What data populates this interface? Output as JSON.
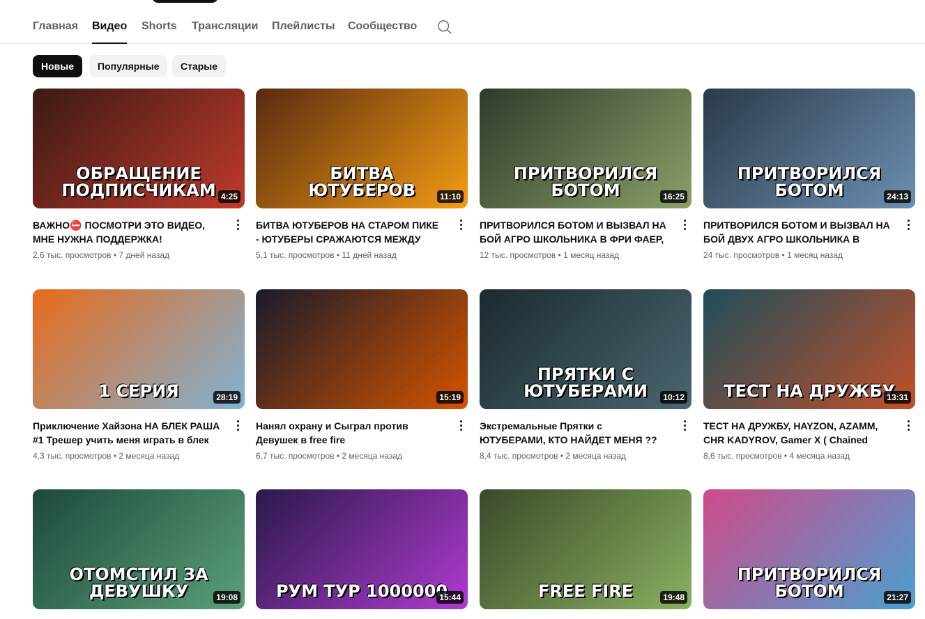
{
  "tabs": [
    "Главная",
    "Видео",
    "Shorts",
    "Трансляции",
    "Плейлисты",
    "Сообщество"
  ],
  "active_tab": 1,
  "chips": [
    "Новые",
    "Популярные",
    "Старые"
  ],
  "videos": [
    {
      "title": "ВАЖНО⛔ ПОСМОТРИ ЭТО ВИДЕО, МНЕ НУЖНА ПОДДЕРЖКА!",
      "views": "2,6 тыс. просмотров",
      "age": "7 дней назад",
      "duration": "4:25",
      "thumb_text": "ОБРАЩЕНИЕ ПОДПИСЧИКАМ",
      "colors": [
        "#3a1a14",
        "#c0392b"
      ]
    },
    {
      "title": "БИТВА ЮТУБЕРОВ НА СТАРОМ ПИКЕ - ЮТУБЕРЫ СРАЖАЮТСЯ МЕЖДУ СОБОЙ",
      "views": "5,1 тыс. просмотров",
      "age": "11 дней назад",
      "duration": "11:10",
      "thumb_text": "БИТВА ЮТУБЕРОВ",
      "colors": [
        "#5a2a10",
        "#f39c12"
      ]
    },
    {
      "title": "ПРИТВОРИЛСЯ БОТОМ И ВЫЗВАЛ НА БОЙ АГРО ШКОЛЬНИКА В ФРИ ФАЕР, Я...",
      "views": "12 тыс. просмотров",
      "age": "1 месяц назад",
      "duration": "16:25",
      "thumb_text": "ПРИТВОРИЛСЯ БОТОМ",
      "colors": [
        "#2f3b2a",
        "#8aa06a"
      ]
    },
    {
      "title": "ПРИТВОРИЛСЯ БОТОМ И ВЫЗВАЛ НА БОЙ ДВУХ АГРО ШКОЛЬНИКА В ФРИ...",
      "views": "24 тыс. просмотров",
      "age": "1 месяц назад",
      "duration": "24:13",
      "thumb_text": "ПРИТВОРИЛСЯ БОТОМ",
      "colors": [
        "#2a3a4a",
        "#6d8fb0"
      ]
    },
    {
      "title": "Приключение Хайзона НА БЛЕК РАША #1 Трешер учить меня играть в блек Раша",
      "views": "4,3 тыс. просмотров",
      "age": "2 месяца назад",
      "duration": "28:19",
      "thumb_text": "1 СЕРИЯ",
      "colors": [
        "#e86a1a",
        "#7fb3d5"
      ]
    },
    {
      "title": "Нанял охрану и Сыграл против Девушек в free fire",
      "views": "6,7 тыс. просмотров",
      "age": "2 месяца назад",
      "duration": "15:19",
      "thumb_text": "",
      "colors": [
        "#1a1a2a",
        "#d35400"
      ]
    },
    {
      "title": "Экстремальные Прятки с ЮТУБЕРАМИ, КТО НАЙДЕТ МЕНЯ ?? ФРИ ФАЕР",
      "views": "8,4 тыс. просмотров",
      "age": "2 месяца назад",
      "duration": "10:12",
      "thumb_text": "ПРЯТКИ С ЮТУБЕРАМИ",
      "colors": [
        "#1b2a30",
        "#4a6670"
      ]
    },
    {
      "title": "ТЕСТ НА ДРУЖБУ, HAYZON, AZAMM, CHR KADYROV, Gamer X ( Chained Together )",
      "views": "8,6 тыс. просмотров",
      "age": "4 месяца назад",
      "duration": "13:31",
      "thumb_text": "ТЕСТ НА ДРУЖБУ",
      "colors": [
        "#1f4d5a",
        "#c0502a"
      ]
    },
    {
      "title": "",
      "views": "",
      "age": "",
      "duration": "19:08",
      "thumb_text": "ОТОМСТИЛ ЗА ДЕВУШКУ",
      "colors": [
        "#1d4a3a",
        "#5aa07a"
      ]
    },
    {
      "title": "",
      "views": "",
      "age": "",
      "duration": "15:44",
      "thumb_text": "РУМ ТУР 1000000",
      "colors": [
        "#2a1a4a",
        "#b03ad0"
      ]
    },
    {
      "title": "",
      "views": "",
      "age": "",
      "duration": "19:48",
      "thumb_text": "FREE FIRE",
      "colors": [
        "#3a4a2a",
        "#8ab060"
      ]
    },
    {
      "title": "",
      "views": "",
      "age": "",
      "duration": "21:27",
      "thumb_text": "ПРИТВОРИЛСЯ БОТОМ",
      "colors": [
        "#d04a8a",
        "#4aa0d0"
      ]
    }
  ]
}
